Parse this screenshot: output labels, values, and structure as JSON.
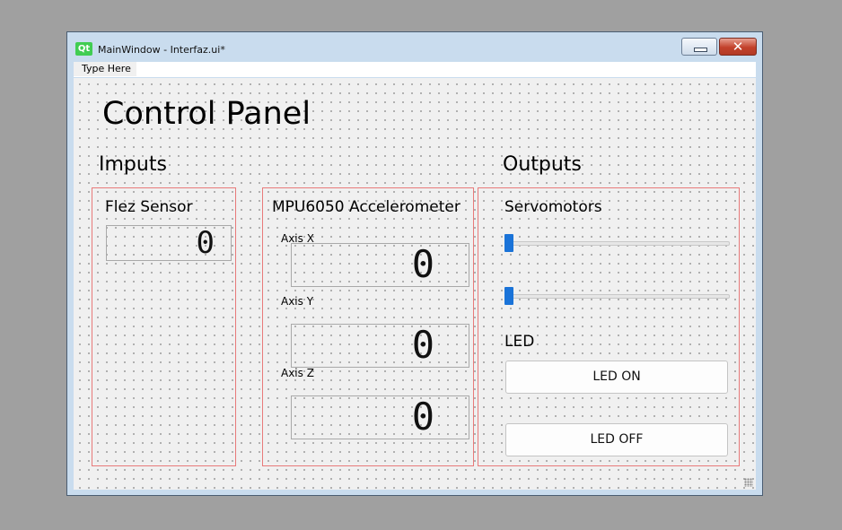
{
  "window": {
    "title": "MainWindow - Interfaz.ui*",
    "logo_text": "Qt",
    "close_glyph": "✕"
  },
  "menubar": {
    "items": [
      {
        "label": "Type Here"
      }
    ]
  },
  "form": {
    "title": "Control Panel",
    "inputs_heading": "Imputs",
    "outputs_heading": "Outputs",
    "flex_group": {
      "title": "Flez Sensor",
      "lcd_value": "0"
    },
    "mpu_group": {
      "title": "MPU6050 Accelerometer",
      "axes": [
        {
          "label": "Axis X",
          "value": "0"
        },
        {
          "label": "Axis Y",
          "value": "0"
        },
        {
          "label": "Axis Z",
          "value": "0"
        }
      ]
    },
    "servo_group": {
      "title": "Servomotors",
      "sliders": [
        {
          "value": 0
        },
        {
          "value": 0
        }
      ],
      "led_heading": "LED",
      "led_on_label": "LED ON",
      "led_off_label": "LED OFF"
    }
  },
  "colors": {
    "group_border": "#e87a7a",
    "slider_handle": "#1a73d8",
    "qt_green": "#41cd52"
  }
}
